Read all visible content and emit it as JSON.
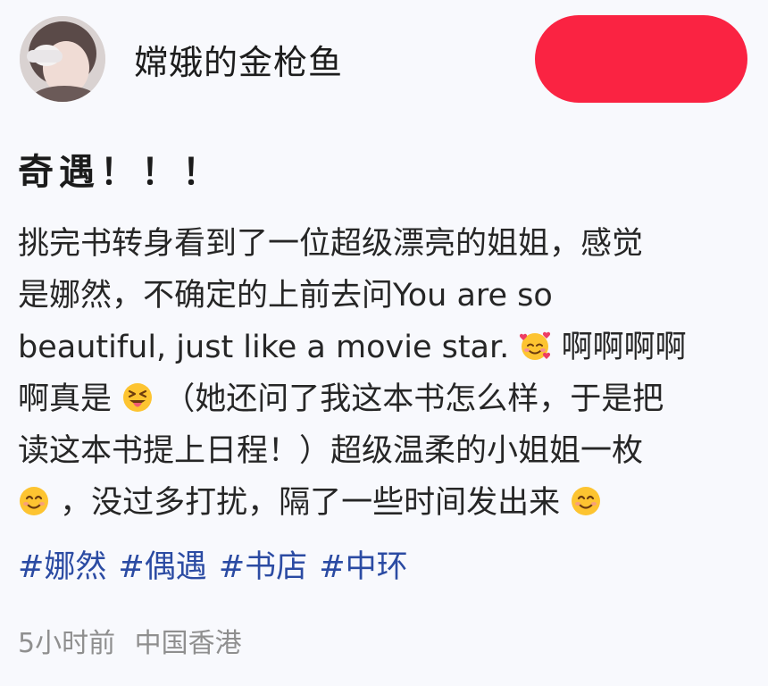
{
  "author": {
    "name": "嫦娥的金枪鱼"
  },
  "colors": {
    "follow_button": "#fa2342",
    "hashtag": "#2b4ba3",
    "meta_text": "#8f8f8f",
    "background": "#f8f9fd"
  },
  "post": {
    "title": "奇遇！！！",
    "lines": [
      [
        "挑完书转身看到了一位超级漂亮的姐姐，感觉"
      ],
      [
        "是娜然，不确定的上前去问You are so"
      ],
      [
        "beautiful, just like a movie star.",
        "smiling-face-with-hearts-icon",
        "啊啊啊啊"
      ],
      [
        "啊真是",
        "squinting-tongue-face-icon",
        " （她还问了我这本书怎么样，于是把"
      ],
      [
        "读这本书提上日程！）超级温柔的小姐姐一枚"
      ],
      [
        "smiling-face-icon",
        "，没过多打扰，隔了一些时间发出来",
        "smiling-face-icon"
      ]
    ],
    "hashtags": [
      "#娜然",
      "#偶遇",
      "#书店",
      "#中环"
    ]
  },
  "meta": {
    "time": "5小时前",
    "location": "中国香港"
  }
}
